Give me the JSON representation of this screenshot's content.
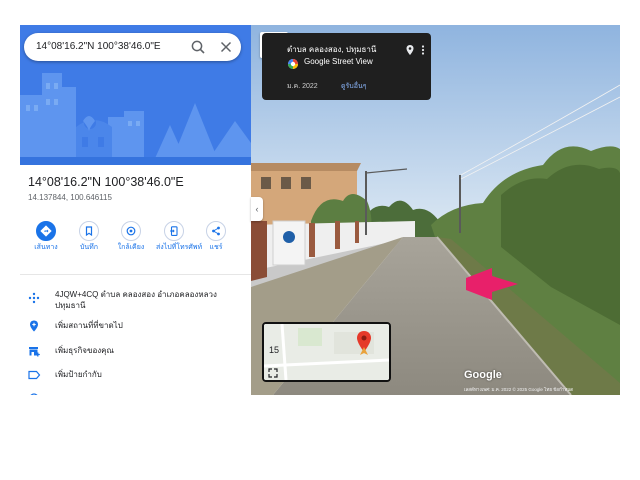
{
  "search": {
    "value": "14°08'16.2\"N 100°38'46.0\"E"
  },
  "place": {
    "title": "14°08'16.2\"N 100°38'46.0\"E",
    "decimal": "14.137844, 100.646115"
  },
  "actions": [
    {
      "label": "เส้นทาง",
      "icon": "directions-icon"
    },
    {
      "label": "บันทึก",
      "icon": "bookmark-icon"
    },
    {
      "label": "ใกล้เคียง",
      "icon": "nearby-icon"
    },
    {
      "label": "ส่งไปที่โทรศัพท์",
      "icon": "send-to-phone-icon"
    },
    {
      "label": "แชร์",
      "icon": "share-icon"
    }
  ],
  "info": [
    {
      "text": "4JQW+4CQ ตำบล คลองสอง อำเภอคลองหลวง ปทุมธานี",
      "icon": "plus-code-icon"
    },
    {
      "text": "เพิ่มสถานที่ที่ขาดไป",
      "icon": "add-place-icon"
    },
    {
      "text": "เพิ่มธุรกิจของคุณ",
      "icon": "business-icon"
    },
    {
      "text": "เพิ่มป้ายกำกับ",
      "icon": "label-icon"
    }
  ],
  "streetview": {
    "place": "ตำบล คลองสอง, ปทุมธานี",
    "brand": "Google Street View",
    "date": "ม.ค. 2022",
    "see_more": "ดูรับอื่นๆ",
    "google_logo": "Google",
    "attribution": "เลสต์ทางเพศ: ม.ค. 2022   © 2025 Google   ไทย   ข้อกำหนด",
    "minimap_label": "15",
    "colors": {
      "arrow": "#e8206a",
      "pin": "#e5392a"
    }
  },
  "colors": {
    "hero": "#3f7be6",
    "accent": "#1a73e8"
  }
}
